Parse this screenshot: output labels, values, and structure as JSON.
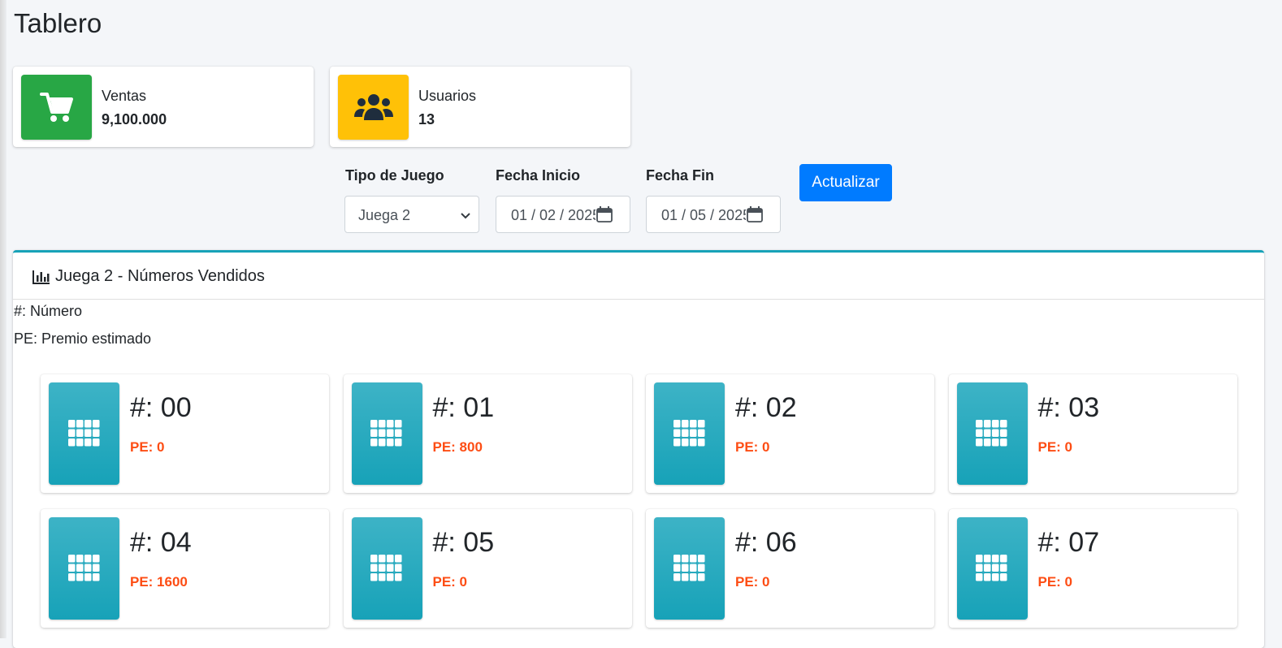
{
  "page": {
    "title": "Tablero"
  },
  "stats": [
    {
      "label": "Ventas",
      "value": "9,100.000",
      "icon": "shopping-cart-icon",
      "color": "#28a745"
    },
    {
      "label": "Usuarios",
      "value": "13",
      "icon": "users-icon",
      "color": "#ffc107"
    }
  ],
  "filters": {
    "game_type": {
      "label": "Tipo de Juego",
      "value": "Juega 2"
    },
    "start_date": {
      "label": "Fecha Inicio",
      "value": "01 / 02 / 2025"
    },
    "end_date": {
      "label": "Fecha Fin",
      "value": "01 / 05 / 2025"
    },
    "update_button": "Actualizar"
  },
  "card": {
    "title": "Juega 2 - Números Vendidos",
    "legend": [
      "#: Número",
      "PE: Premio estimado"
    ],
    "accent_color": "#17a2b8",
    "prize_color": "#fd4d14",
    "numbers": [
      {
        "number": "#: 00",
        "pe": "PE: 0"
      },
      {
        "number": "#: 01",
        "pe": "PE: 800"
      },
      {
        "number": "#: 02",
        "pe": "PE: 0"
      },
      {
        "number": "#: 03",
        "pe": "PE: 0"
      },
      {
        "number": "#: 04",
        "pe": "PE: 1600"
      },
      {
        "number": "#: 05",
        "pe": "PE: 0"
      },
      {
        "number": "#: 06",
        "pe": "PE: 0"
      },
      {
        "number": "#: 07",
        "pe": "PE: 0"
      }
    ]
  }
}
